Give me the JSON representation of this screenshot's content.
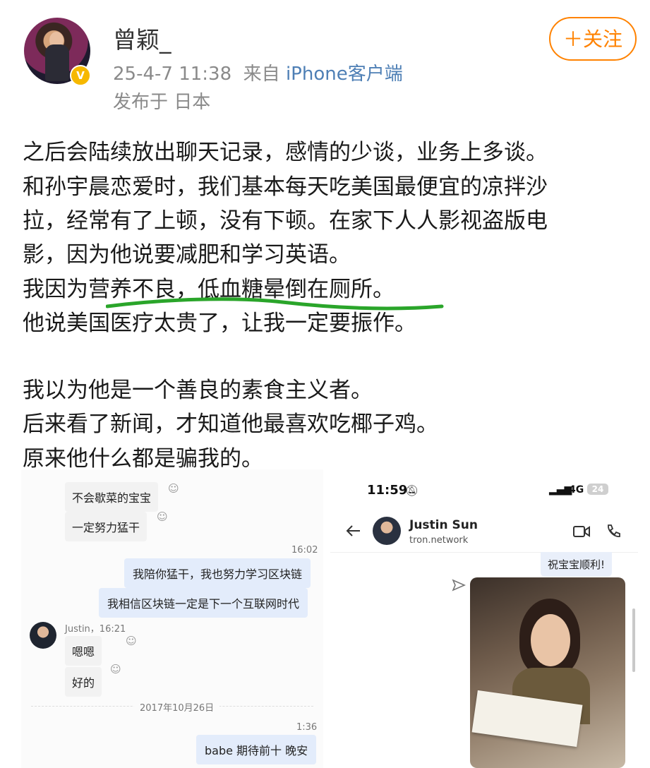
{
  "header": {
    "username": "曾颖_",
    "datetime": "25-4-7 11:38",
    "source_prefix": "来自",
    "source": "iPhone客户端",
    "location": "发布于 日本",
    "follow_label": "＋关注",
    "badge_icon": "verified-v-icon",
    "accent_color": "#ff8200",
    "badge_color": "#f6b800"
  },
  "post": {
    "lines": [
      "之后会陆续放出聊天记录，感情的少谈，业务上多谈。",
      "和孙宇晨恋爱时，我们基本每天吃美国最便宜的凉拌沙",
      "拉，经常有了上顿，没有下顿。在家下人人影视盗版电",
      "影，因为他说要减肥和学习英语。",
      "我因为营养不良，低血糖晕倒在厕所。",
      "他说美国医疗太贵了，让我一定要振作。",
      "我以为他是一个善良的素食主义者。",
      "后来看了新闻，才知道他最喜欢吃椰子鸡。",
      "原来他什么都是骗我的。"
    ],
    "underline_color": "#2aa52a"
  },
  "chat_left": {
    "msg1": "不会歇菜的宝宝",
    "msg2": "一定努力猛干",
    "time1": "16:02",
    "msg3": "我陪你猛干，我也努力学习区块链",
    "msg4": "我相信区块链一定是下一个互联网时代",
    "sender_meta": "Justin，16:21",
    "msg5": "嗯嗯",
    "msg6": "好的",
    "date_divider": "2017年10月26日",
    "time2": "1:36",
    "msg7": "babe 期待前十 晚安"
  },
  "chat_right": {
    "clock": "11:59",
    "mute_icon": "bell-slash-icon",
    "signal": "4G",
    "battery": "24",
    "contact_name": "Justin Sun",
    "contact_sub": "tron.network",
    "back_icon": "back-arrow-icon",
    "video_icon": "video-call-icon",
    "call_icon": "phone-call-icon",
    "msg1": "祝宝宝顺利!",
    "share_icon": "share-forward-icon"
  }
}
